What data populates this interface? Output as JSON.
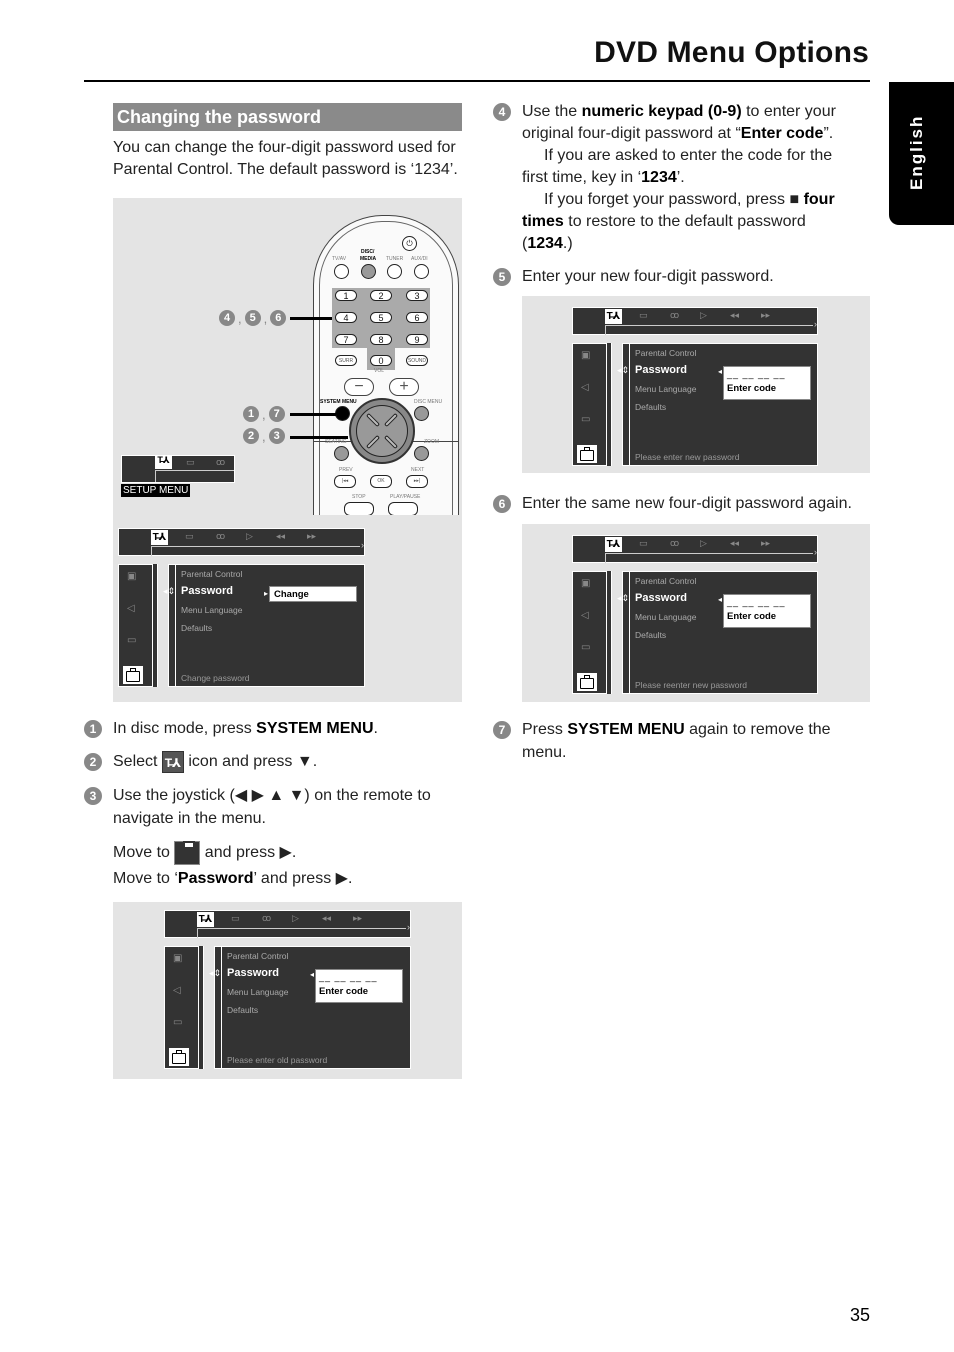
{
  "header": {
    "title": "DVD Menu Options",
    "language_tab": "English",
    "page_number": "35"
  },
  "section": {
    "heading": "Changing the password",
    "intro": "You can change the four-digit password used for Parental Control. The default password is ‘1234’."
  },
  "remote": {
    "labels": {
      "tv_av": "TV/AV",
      "disc_media_1": "DISC/",
      "disc_media_2": "MEDIA",
      "tuner": "TUNER",
      "aux": "AUX/DI",
      "surr": "SURR",
      "sound": "SOUND",
      "vol": "VOL",
      "system_menu": "SYSTEM MENU",
      "disc_menu": "DISC MENU",
      "seating": "SEATING",
      "zoom": "ZOOM",
      "prev": "PREV",
      "next": "NEXT",
      "stop": "STOP",
      "play_pause": "PLAY/PAUSE",
      "ok": "OK"
    },
    "keys": [
      "1",
      "2",
      "3",
      "4",
      "5",
      "6",
      "7",
      "8",
      "9",
      "0"
    ],
    "callouts": {
      "keypad": [
        "4",
        "5",
        "6"
      ],
      "system_menu": [
        "1",
        "7"
      ],
      "joystick": [
        "2",
        "3"
      ]
    }
  },
  "setup_mini": {
    "label": "SETUP MENU",
    "selected_icon": "T̶⅄"
  },
  "menu_common": {
    "top_icons": [
      "▭",
      "ꝏ",
      "▷",
      "◂◂",
      "▸▸"
    ],
    "items": [
      "Parental Control",
      "Password",
      "Menu Language",
      "Defaults"
    ],
    "dashes": "__ __ __ __"
  },
  "screens": [
    {
      "id": "change",
      "popup": "Change",
      "status": "Change  password"
    },
    {
      "id": "old",
      "popup": "Enter code",
      "status": "Please enter old password"
    },
    {
      "id": "new",
      "popup": "Enter code",
      "status": "Please enter new password"
    },
    {
      "id": "reenter",
      "popup": "Enter code",
      "status": "Please reenter new password"
    }
  ],
  "steps": {
    "s1": {
      "num": "1",
      "pre": "In disc mode, press ",
      "bold": "SYSTEM MENU",
      "post": "."
    },
    "s2": {
      "num": "2",
      "pre": "Select ",
      "icon": "T̶⅄",
      "post": " icon and press ▼."
    },
    "s3": {
      "num": "3",
      "line1": "Use the joystick (◀ ▶ ▲ ▼) on the remote to",
      "line2": "navigate in the menu.",
      "move1_pre": "Move to ",
      "move1_post": " and press ▶.",
      "move2_pre": "Move to ‘",
      "move2_bold": "Password",
      "move2_post": "’ and press ▶."
    },
    "s4": {
      "num": "4",
      "l1_pre": "Use the ",
      "l1_bold": "numeric keypad (0-9)",
      "l1_post": " to enter your",
      "l2_pre": "original four-digit password at “",
      "l2_bold": "Enter code",
      "l2_post": "”.",
      "l3": "If you are asked to enter the code for the",
      "l4_pre": "first time, key in ‘",
      "l4_bold": "1234",
      "l4_post": "’.",
      "l5_pre": "If you forget your password, press  ■  ",
      "l5_bold": "four",
      "l6_bold": "times",
      "l6_post": " to restore to the default password",
      "l7_pre": "(",
      "l7_bold": "1234",
      "l7_post": ".)"
    },
    "s5": {
      "num": "5",
      "text": "Enter your new four-digit password."
    },
    "s6": {
      "num": "6",
      "text": "Enter the same new four-digit password again."
    },
    "s7": {
      "num": "7",
      "pre": "Press ",
      "bold": "SYSTEM MENU",
      "post": " again to remove the",
      "line2": "menu."
    }
  }
}
